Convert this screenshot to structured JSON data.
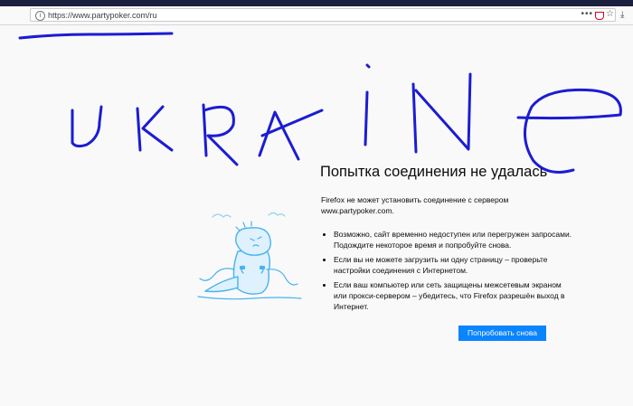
{
  "browser": {
    "url": "https://www.partypoker.com/ru",
    "menu_glyph": "•••",
    "star_glyph": "☆",
    "download_glyph": "⤓",
    "info_glyph": "i"
  },
  "handwriting": {
    "text": "UKRAINE",
    "color": "#1c1cd4"
  },
  "error_page": {
    "title": "Попытка соединения не удалась",
    "intro": "Firefox не может установить соединение с сервером www.partypoker.com.",
    "reasons": [
      "Возможно, сайт временно недоступен или перегружен запросами. Подождите некоторое время и попробуйте снова.",
      "Если вы не можете загрузить ни одну страницу – проверьте настройки соединения с Интернетом.",
      "Если ваш компьютер или сеть защищены межсетевым экраном или прокси-сервером – убедитесь, что Firefox разрешён выход в Интернет."
    ],
    "retry_label": "Попробовать снова",
    "accent_color": "#0a84ff",
    "illustration": "sad-dinosaur-unplugged-cable"
  }
}
